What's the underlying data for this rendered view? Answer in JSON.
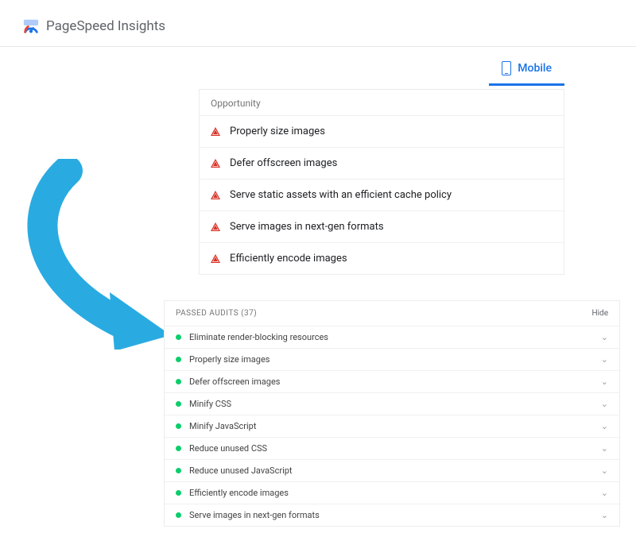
{
  "app": {
    "title": "PageSpeed Insights"
  },
  "tabs": {
    "mobile": "Mobile"
  },
  "opportunity": {
    "heading": "Opportunity",
    "items": [
      {
        "label": "Properly size images"
      },
      {
        "label": "Defer offscreen images"
      },
      {
        "label": "Serve static assets with an efficient cache policy"
      },
      {
        "label": "Serve images in next-gen formats"
      },
      {
        "label": "Efficiently encode images"
      }
    ]
  },
  "passed": {
    "heading": "PASSED AUDITS (37)",
    "hide": "Hide",
    "items": [
      {
        "label": "Eliminate render-blocking resources"
      },
      {
        "label": "Properly size images"
      },
      {
        "label": "Defer offscreen images"
      },
      {
        "label": "Minify CSS"
      },
      {
        "label": "Minify JavaScript"
      },
      {
        "label": "Reduce unused CSS"
      },
      {
        "label": "Reduce unused JavaScript"
      },
      {
        "label": "Efficiently encode images"
      },
      {
        "label": "Serve images in next-gen formats"
      }
    ]
  }
}
